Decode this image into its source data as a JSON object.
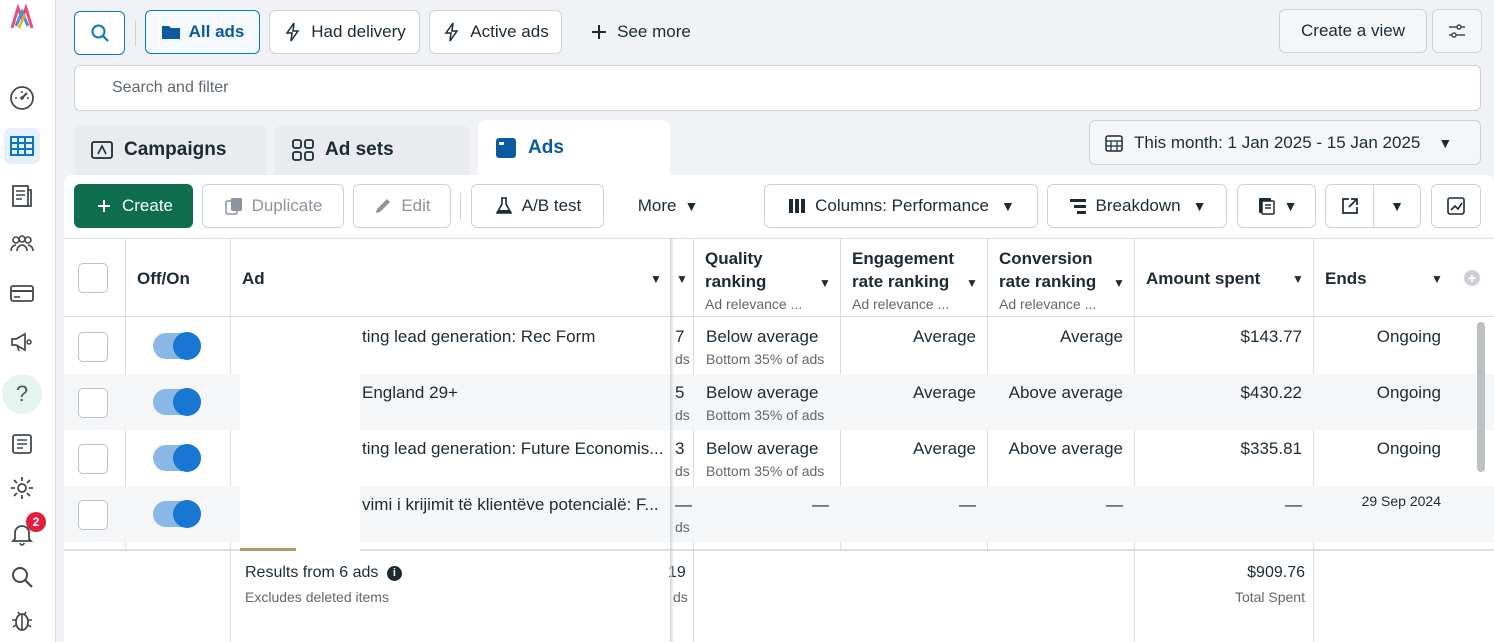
{
  "viewbar": {
    "all_ads": "All ads",
    "had_delivery": "Had delivery",
    "active_ads": "Active ads",
    "see_more": "See more",
    "create_view": "Create a view"
  },
  "search": {
    "placeholder": "Search and filter"
  },
  "tabs": {
    "campaigns": "Campaigns",
    "ad_sets": "Ad sets",
    "ads": "Ads"
  },
  "date_range": "This month: 1 Jan 2025 - 15 Jan 2025",
  "toolbar": {
    "create": "Create",
    "duplicate": "Duplicate",
    "edit": "Edit",
    "ab_test": "A/B test",
    "more": "More",
    "columns": "Columns: Performance",
    "breakdown": "Breakdown"
  },
  "table": {
    "headers": {
      "off_on": "Off/On",
      "ad": "Ad",
      "quality_1": "Quality",
      "quality_2": "ranking",
      "quality_sub": "Ad relevance ...",
      "engagement_1": "Engagement",
      "engagement_2": "rate ranking",
      "engagement_sub": "Ad relevance ...",
      "conversion_1": "Conversion",
      "conversion_2": "rate ranking",
      "conversion_sub": "Ad relevance ...",
      "amount_spent": "Amount spent",
      "ends": "Ends"
    },
    "rows": [
      {
        "ad": "ting lead generation: Rec Form",
        "cut_top": "7",
        "cut_bottom": "ds",
        "quality": "Below average",
        "quality_sub": "Bottom 35% of ads",
        "engagement": "Average",
        "conversion": "Average",
        "amount": "$143.77",
        "ends": "Ongoing"
      },
      {
        "ad": "England 29+",
        "cut_top": "5",
        "cut_bottom": "ds",
        "quality": "Below average",
        "quality_sub": "Bottom 35% of ads",
        "engagement": "Average",
        "conversion": "Above average",
        "amount": "$430.22",
        "ends": "Ongoing"
      },
      {
        "ad": "ting lead generation: Future Economis...",
        "cut_top": "3",
        "cut_bottom": "ds",
        "quality": "Below average",
        "quality_sub": "Bottom 35% of ads",
        "engagement": "Average",
        "conversion": "Above average",
        "amount": "$335.81",
        "ends": "Ongoing"
      },
      {
        "ad": "vimi i krijimit të klientëve potencialë: F...",
        "cut_top": "—",
        "cut_bottom": "ds",
        "quality": "—",
        "quality_sub": "",
        "engagement": "—",
        "conversion": "—",
        "amount": "—",
        "ends": "29 Sep 2024"
      }
    ],
    "footer": {
      "results": "Results from 6 ads",
      "excludes": "Excludes deleted items",
      "cut_top": "19",
      "cut_bottom": "ds",
      "total": "$909.76",
      "total_label": "Total Spent"
    }
  },
  "notifications_count": "2",
  "help_glyph": "?",
  "colors": {
    "primary_green": "#0e6e4e",
    "selected_blue": "#0a78be",
    "toggle_on": "#1877d2",
    "badge_red": "#e41e3f"
  }
}
